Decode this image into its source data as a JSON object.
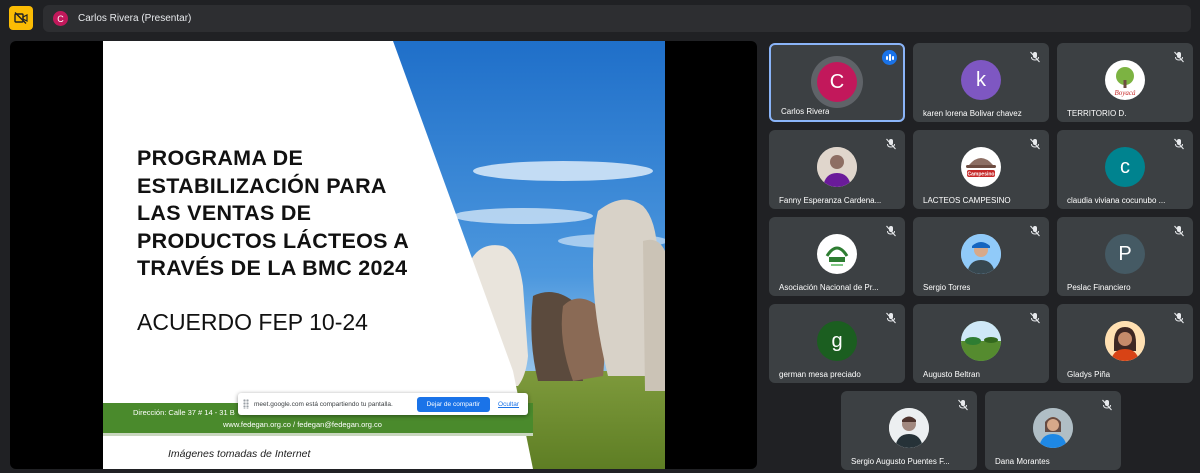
{
  "presenter": {
    "initial": "C",
    "label": "Carlos Rivera (Presentar)",
    "avatar_color": "#c2185b"
  },
  "slide": {
    "title_lines": [
      "PROGRAMA DE",
      "ESTABILIZACIÓN PARA",
      "LAS VENTAS DE",
      "PRODUCTOS LÁCTEOS A",
      "TRAVÉS DE LA BMC 2024"
    ],
    "subtitle": "ACUERDO FEP 10-24",
    "footer_address": "Dirección: Calle 37 # 14 - 31 B",
    "footer_web": "www.fedegan.org.co  /  fedegan@fedegan.org.co",
    "footer_note": "Imágenes tomadas de Internet",
    "accent_green": "#4a8a2c"
  },
  "share_bar": {
    "message": "meet.google.com está compartiendo tu pantalla.",
    "stop_label": "Dejar de compartir",
    "hide_label": "Ocultar"
  },
  "participants": [
    {
      "name": "Carlos Rivera",
      "initial": "C",
      "avatar": "letter",
      "color": "#c2185b",
      "speaking": true
    },
    {
      "name": "karen lorena Bolivar chavez",
      "initial": "k",
      "avatar": "letter",
      "color": "#7e57c2"
    },
    {
      "name": "TERRITORIO D.",
      "avatar": "boyaca-logo-icon"
    },
    {
      "name": "Fanny Esperanza Cardena...",
      "avatar": "person-photo-icon"
    },
    {
      "name": "LACTEOS CAMPESINO",
      "avatar": "campesino-logo-icon"
    },
    {
      "name": "claudia viviana cocunubo ...",
      "initial": "c",
      "avatar": "letter",
      "color": "#00838f"
    },
    {
      "name": "Asociación Nacional de Pr...",
      "avatar": "anal-logo-icon"
    },
    {
      "name": "Sergio Torres",
      "avatar": "person-photo-icon"
    },
    {
      "name": "Peslac Financiero",
      "initial": "P",
      "avatar": "letter",
      "color": "#455a64"
    },
    {
      "name": "german mesa preciado",
      "initial": "g",
      "avatar": "letter",
      "color": "#1b5e20"
    },
    {
      "name": "Augusto Beltran",
      "avatar": "landscape-photo-icon"
    },
    {
      "name": "Gladys Piña",
      "avatar": "person-photo-icon"
    },
    {
      "name": "Sergio Augusto Puentes F...",
      "avatar": "person-photo-icon"
    },
    {
      "name": "Dana Morantes",
      "avatar": "person-photo-icon"
    }
  ]
}
